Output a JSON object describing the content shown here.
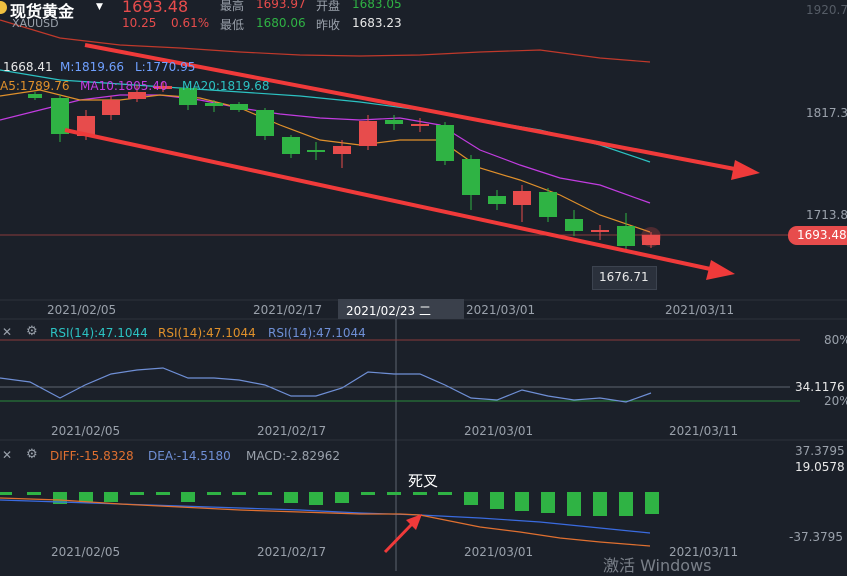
{
  "header": {
    "name": "现货黄金",
    "code": "XAUUSD",
    "price": "1693.48",
    "change": "10.25",
    "change_pct": "0.61%",
    "high_label": "最高",
    "high": "1693.97",
    "low_label": "最低",
    "low": "1680.06",
    "open_label": "开盘",
    "open": "1683.05",
    "prev_label": "昨收",
    "prev": "1683.23"
  },
  "legend": {
    "ma_t": "1668.41",
    "ma_m": "M:1819.66",
    "ma_l": "L:1770.95",
    "ma5": "A5:1789.76",
    "ma10": "MA10:1805.40",
    "ma20": "MA20:1819.68"
  },
  "main_axis": {
    "p1920": "1920.7",
    "p1817": "1817.3",
    "p1713": "1713.8",
    "current": "1693.48"
  },
  "low_marker": "1676.71",
  "dates": [
    "2021/02/05",
    "2021/02/17",
    "2021/03/01",
    "2021/03/11"
  ],
  "crosshair_date": "2021/02/23 二",
  "rsi": {
    "l1": "RSI(14):47.1044",
    "l2": "RSI(14):47.1044",
    "l3": "RSI(14):47.1044",
    "top": "80%",
    "value": "34.1176",
    "bottom": "20%"
  },
  "macd": {
    "diff": "DIFF:-15.8328",
    "dea": "DEA:-14.5180",
    "macd": "MACD:-2.82962",
    "top": "37.3795",
    "value": "19.0578",
    "bottom": "-37.3795",
    "annotation": "死叉"
  },
  "watermark": "激活 Windows",
  "colors": {
    "up": "#e74c4c",
    "down": "#2fb344",
    "bg": "#1b2029"
  }
}
